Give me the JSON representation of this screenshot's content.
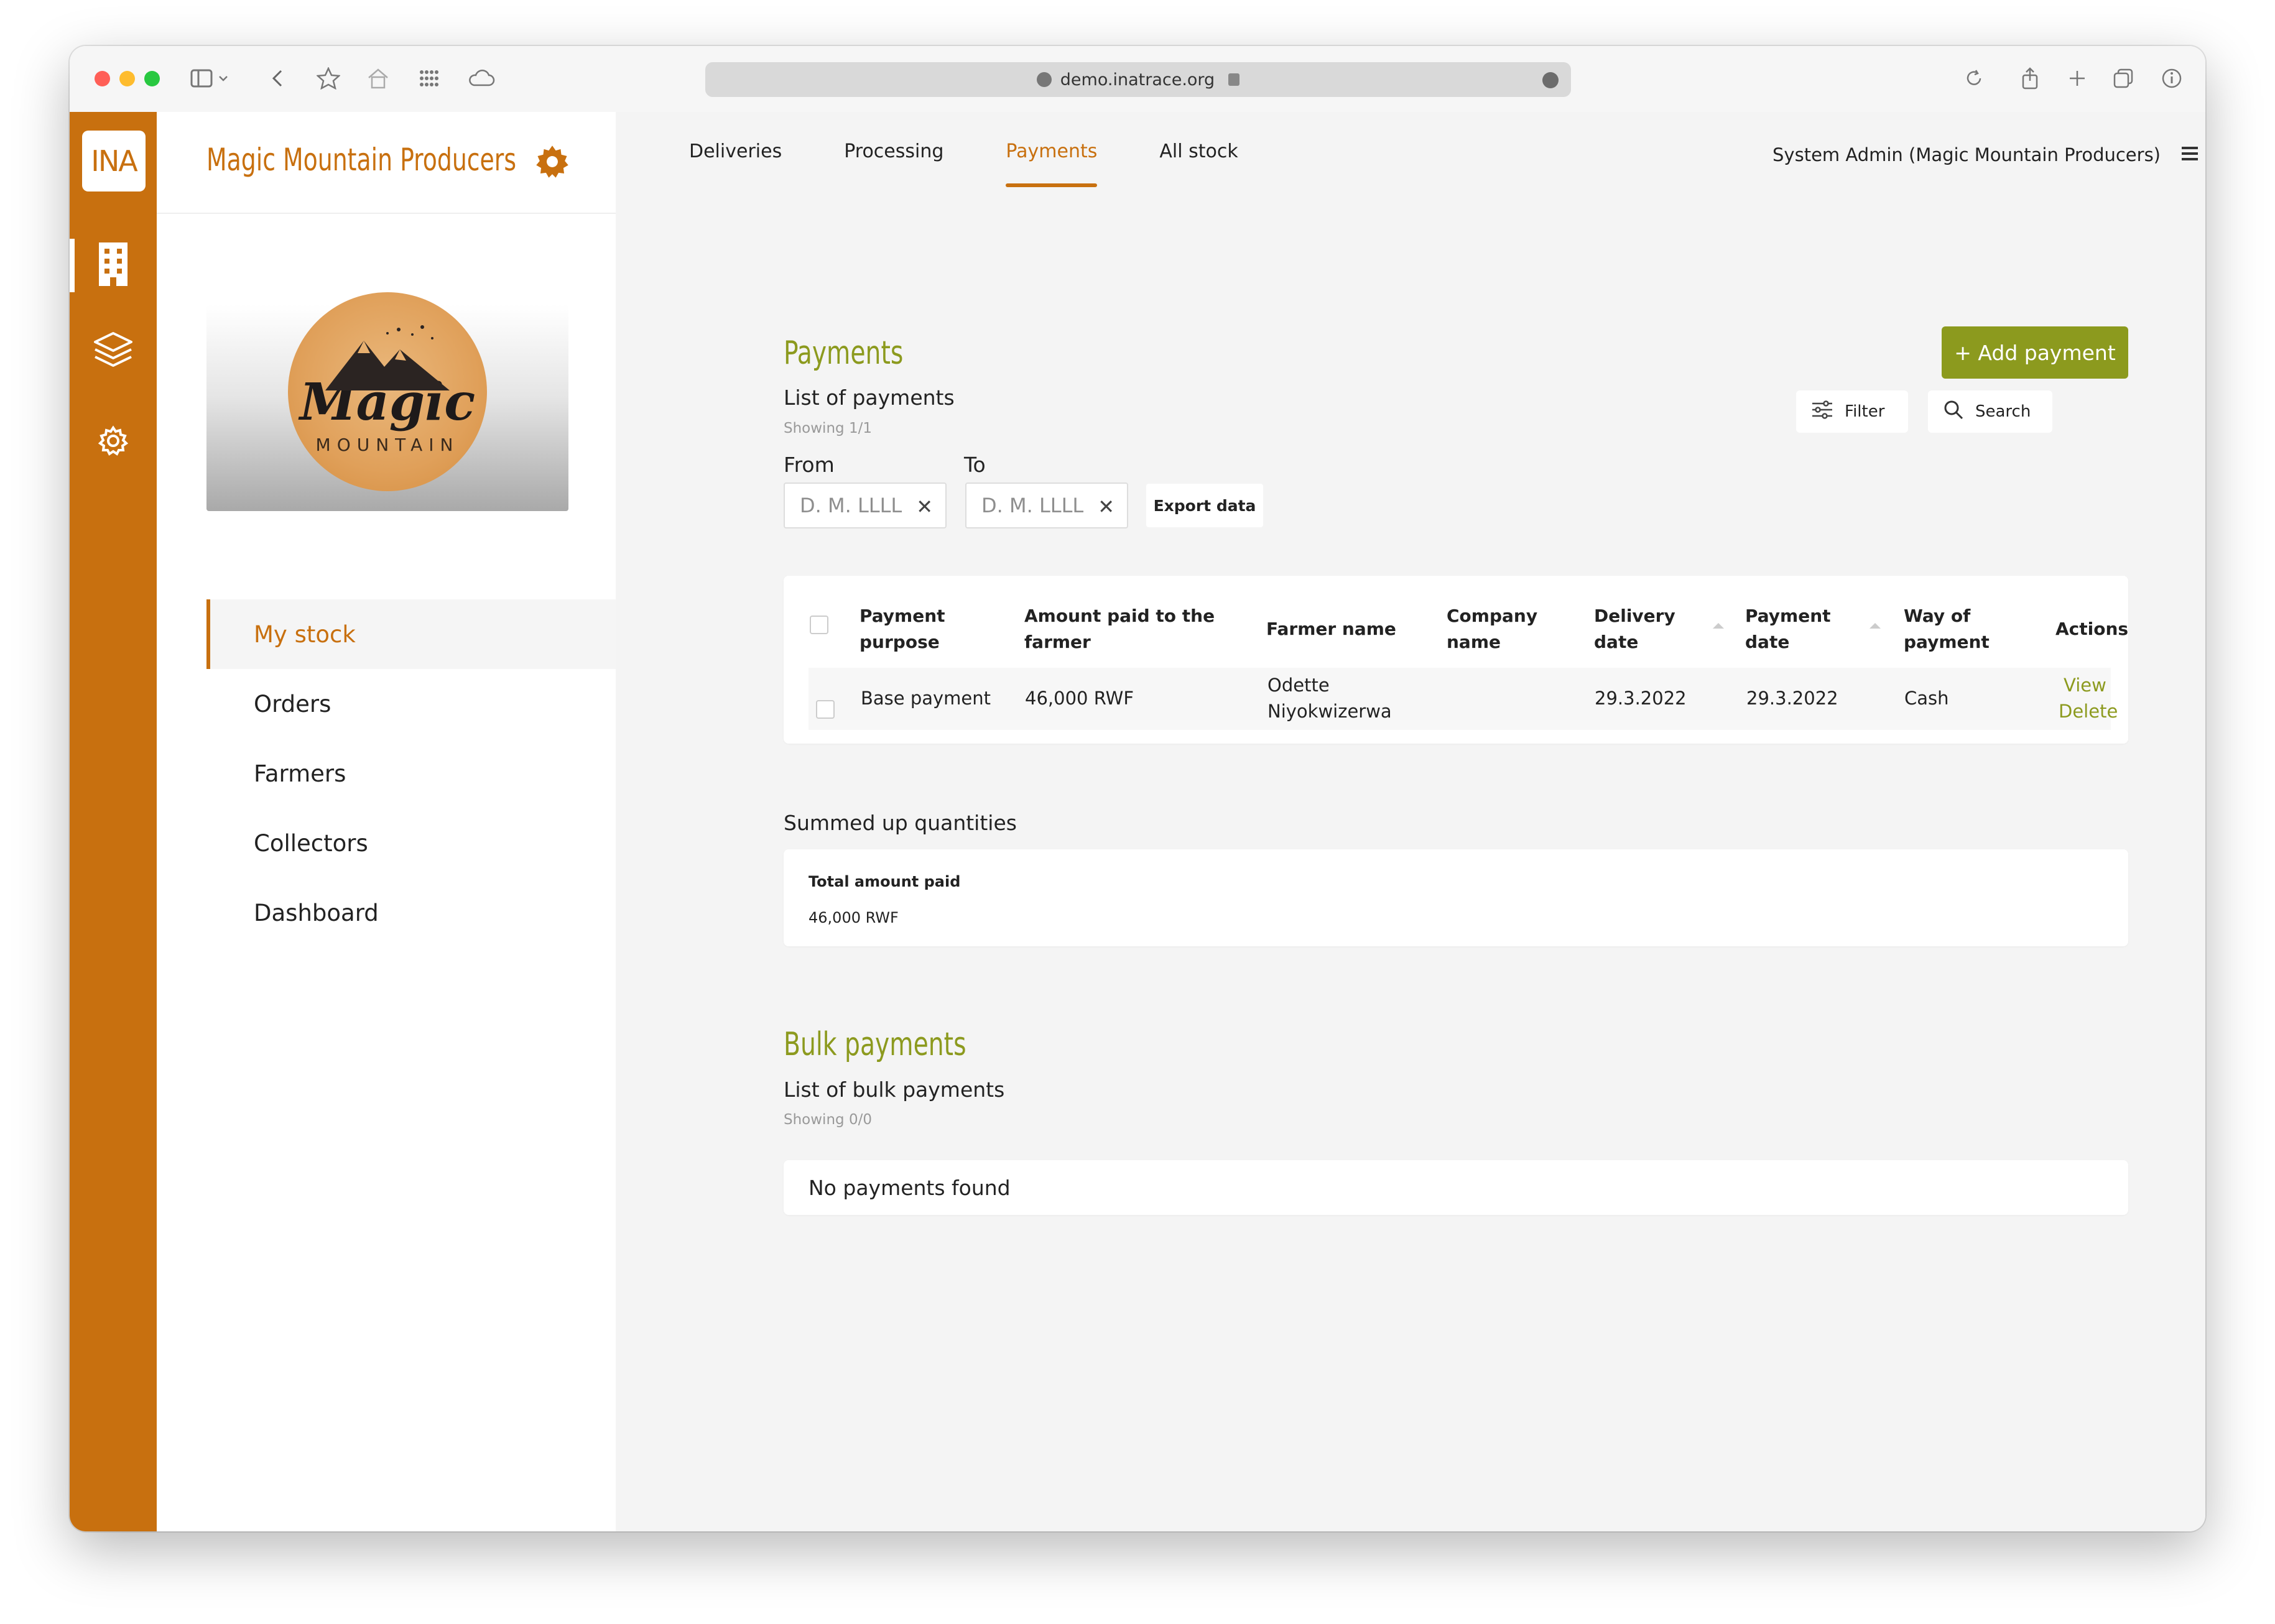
{
  "browser": {
    "url": "demo.inatrace.org"
  },
  "rail": {
    "logo_text": "INA",
    "items": [
      {
        "icon": "building-icon",
        "active": true
      },
      {
        "icon": "layers-icon",
        "active": false
      },
      {
        "icon": "gear-icon",
        "active": false
      }
    ]
  },
  "sidebar": {
    "org_name": "Magic Mountain Producers",
    "logo": {
      "word": "Magic",
      "subword": "MOUNTAIN"
    },
    "nav": [
      {
        "label": "My stock",
        "active": true
      },
      {
        "label": "Orders",
        "active": false
      },
      {
        "label": "Farmers",
        "active": false
      },
      {
        "label": "Collectors",
        "active": false
      },
      {
        "label": "Dashboard",
        "active": false
      }
    ]
  },
  "header": {
    "tabs": [
      {
        "label": "Deliveries",
        "active": false
      },
      {
        "label": "Processing",
        "active": false
      },
      {
        "label": "Payments",
        "active": true
      },
      {
        "label": "All stock",
        "active": false
      }
    ],
    "user": "System Admin (Magic Mountain Producers)"
  },
  "payments": {
    "title": "Payments",
    "subtitle": "List of payments",
    "showing": "Showing 1/1",
    "add_button": "+ Add payment",
    "filter_label": "Filter",
    "search_label": "Search",
    "from_label": "From",
    "to_label": "To",
    "from_placeholder": "D. M. LLLL",
    "to_placeholder": "D. M. LLLL",
    "export_label": "Export data",
    "columns": [
      [
        "Payment",
        "purpose"
      ],
      [
        "Amount paid to the",
        "farmer"
      ],
      [
        "Farmer name"
      ],
      [
        "Company",
        "name"
      ],
      [
        "Delivery",
        "date"
      ],
      [
        "Payment",
        "date"
      ],
      [
        "Way of",
        "payment"
      ],
      [
        "Actions"
      ]
    ],
    "rows": [
      {
        "purpose": "Base payment",
        "amount": "46,000 RWF",
        "farmer_line1": "Odette",
        "farmer_line2": "Niyokwizerwa",
        "company": "",
        "delivery_date": "29.3.2022",
        "payment_date": "29.3.2022",
        "way": "Cash",
        "action_view": "View",
        "action_delete": "Delete"
      }
    ]
  },
  "summary": {
    "title": "Summed up quantities",
    "total_label": "Total amount paid",
    "total_value": "46,000 RWF"
  },
  "bulk": {
    "title": "Bulk payments",
    "subtitle": "List of bulk payments",
    "showing": "Showing 0/0",
    "empty_text": "No payments found"
  },
  "colors": {
    "brand_orange": "#c8700f",
    "accent_olive": "#8c9a1e"
  }
}
